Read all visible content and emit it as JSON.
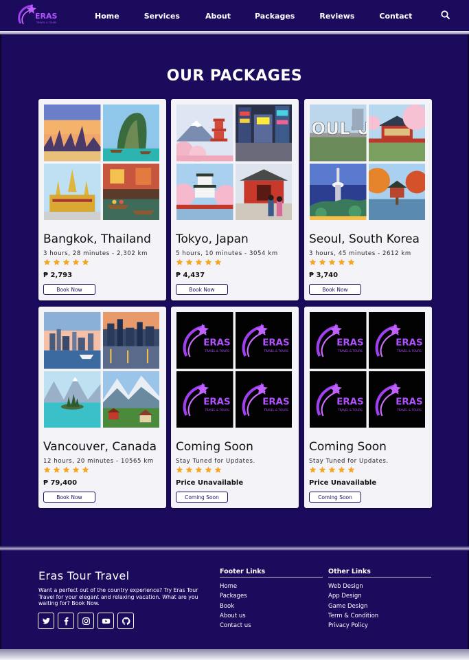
{
  "nav": {
    "logo_text": "ERAS",
    "logo_sub": "TRAVEL & TOURS",
    "links": [
      "Home",
      "Services",
      "About",
      "Packages",
      "Reviews",
      "Contact"
    ]
  },
  "section_title": "OUR PACKAGES",
  "packages": [
    {
      "title": "Bangkok, Thailand",
      "meta": "3 hours, 28 minutes - 2,302 km",
      "price": "₱ 2,793",
      "button": "Book Now",
      "rating": 5,
      "tiles": [
        "bangkok-sunset",
        "thai-beach",
        "grand-palace",
        "floating-market"
      ]
    },
    {
      "title": "Tokyo, Japan",
      "meta": "5 hours, 10 minutes - 3054 km",
      "price": "₱ 4,437",
      "button": "Book Now",
      "rating": 5,
      "tiles": [
        "fuji-pagoda",
        "shinjuku-street",
        "castle-cherry",
        "asakusa-temple"
      ]
    },
    {
      "title": "Seoul, South Korea",
      "meta": "3 hours, 45 minutes - 2612 km",
      "price": "₱ 3,740",
      "button": "Book Now",
      "rating": 5,
      "tiles": [
        "i-seoul-u-sign",
        "palace-cherry",
        "namsan-tower",
        "autumn-pavilion"
      ]
    },
    {
      "title": "Vancouver, Canada",
      "meta": "12 hours, 20 minutes - 10565 km",
      "price": "₱ 79,400",
      "button": "Book Now",
      "rating": 5,
      "tiles": [
        "vancouver-skyline",
        "harbour-night",
        "lake-island",
        "mountain-village"
      ]
    },
    {
      "title": "Coming Soon",
      "meta": "Stay Tuned for Updates.",
      "price": "Price Unavailable",
      "button": "Coming Soon",
      "rating": 5,
      "tiles": [
        "eras-logo",
        "eras-logo",
        "eras-logo",
        "eras-logo"
      ]
    },
    {
      "title": "Coming Soon",
      "meta": "Stay Tuned for Updates.",
      "price": "Price Unavailable",
      "button": "Coming Soon",
      "rating": 5,
      "tiles": [
        "eras-logo",
        "eras-logo",
        "eras-logo",
        "eras-logo"
      ]
    }
  ],
  "footer": {
    "brand": "Eras Tour Travel",
    "description": "Want a perfect out of the country experience? Try Eras Tour Travel for your elegant and relaxing vacation. What are you waiting for? Book Now.",
    "socials": [
      "twitter-icon",
      "facebook-icon",
      "instagram-icon",
      "youtube-icon",
      "github-icon"
    ],
    "footer_links_title": "Footer Links",
    "footer_links": [
      "Home",
      "Packages",
      "Book",
      "About us",
      "Contact us"
    ],
    "other_links_title": "Other Links",
    "other_links": [
      "Web Design",
      "App Design",
      "Game Design",
      "Term & Condition",
      "Privacy Policy"
    ]
  },
  "colors": {
    "brand_navy": "#1c0a5c",
    "card_bg": "#f3f3f8",
    "star": "#f5a623",
    "logo_purple": "#a040f0"
  }
}
